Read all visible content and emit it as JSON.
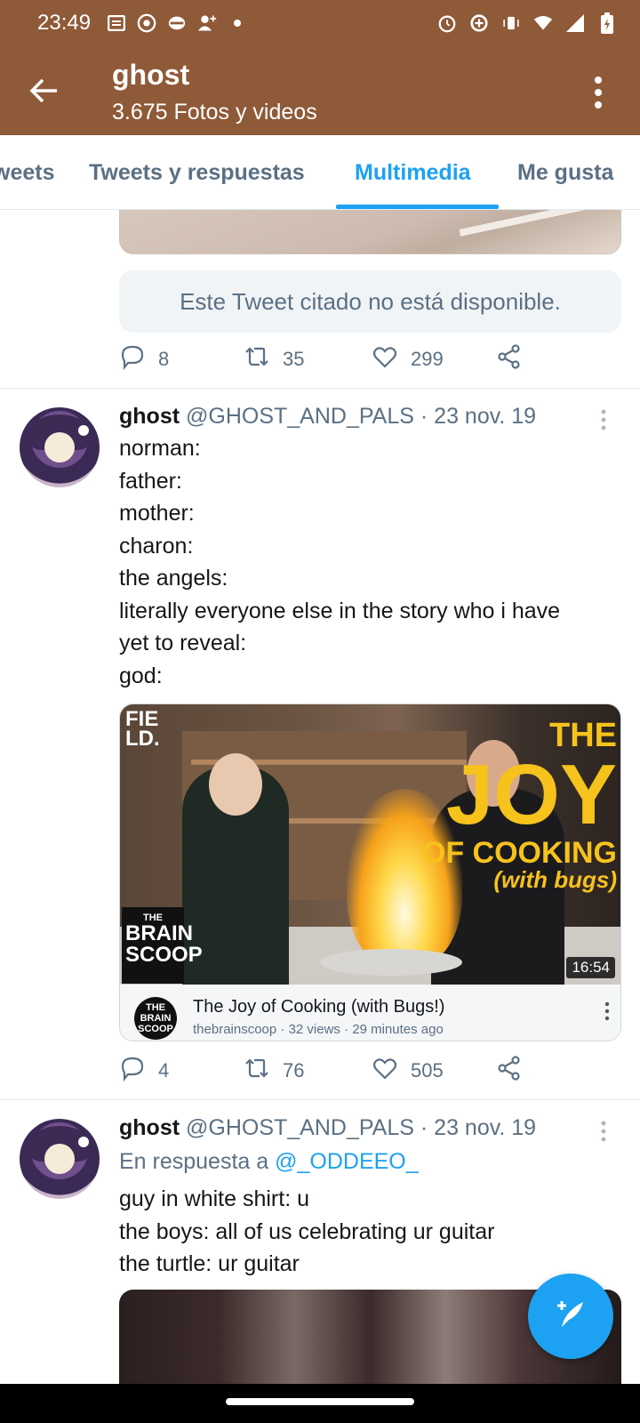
{
  "status_bar": {
    "time": "23:49",
    "left_icons": [
      "notes-icon",
      "signal-app-icon",
      "vpn-icon",
      "add-person-icon",
      "dot-icon"
    ],
    "right_icons": [
      "alarm-icon",
      "data-saver-icon",
      "vibrate-icon",
      "wifi-icon",
      "cell-signal-icon",
      "battery-icon"
    ]
  },
  "header": {
    "title": "ghost",
    "subtitle": "3.675 Fotos y videos",
    "bg_color": "#8f5a38"
  },
  "tabs": [
    {
      "label": "weets",
      "active": false
    },
    {
      "label": "Tweets y respuestas",
      "active": false
    },
    {
      "label": "Multimedia",
      "active": true
    },
    {
      "label": "Me gusta",
      "active": false
    }
  ],
  "accent_color": "#1da1f2",
  "tweet1": {
    "quoted_unavailable": "Este Tweet citado no está disponible.",
    "replies": "8",
    "retweets": "35",
    "likes": "299"
  },
  "tweet2": {
    "name": "ghost",
    "handle": "@GHOST_AND_PALS",
    "date": "· 23 nov. 19",
    "lines": [
      "norman:",
      "father:",
      "mother:",
      "charon:",
      "the angels:",
      "literally everyone else in the story who i have",
      "yet to reveal:",
      "god:"
    ],
    "video": {
      "field_logo_1": "FIE",
      "field_logo_2": "LD.",
      "art_line1": "THE",
      "art_line2": "JOY",
      "art_line3": "OF COOKING",
      "art_line4": "(with bugs)",
      "brain_small": "THE",
      "brain_1": "BRAIN",
      "brain_2": "SCOOP",
      "duration": "16:54",
      "title": "The Joy of Cooking (with Bugs!)",
      "meta": "thebrainscoop · 32 views · 29 minutes ago"
    },
    "replies": "4",
    "retweets": "76",
    "likes": "505"
  },
  "tweet3": {
    "name": "ghost",
    "handle": "@GHOST_AND_PALS",
    "date": "· 23 nov. 19",
    "reply_prefix": "En respuesta a",
    "reply_handle": "@_ODDEEO_",
    "lines": [
      "guy in white shirt: u",
      "the boys: all of us celebrating ur guitar",
      "the turtle: ur guitar"
    ]
  },
  "fab": {
    "icon": "compose-tweet-icon"
  }
}
